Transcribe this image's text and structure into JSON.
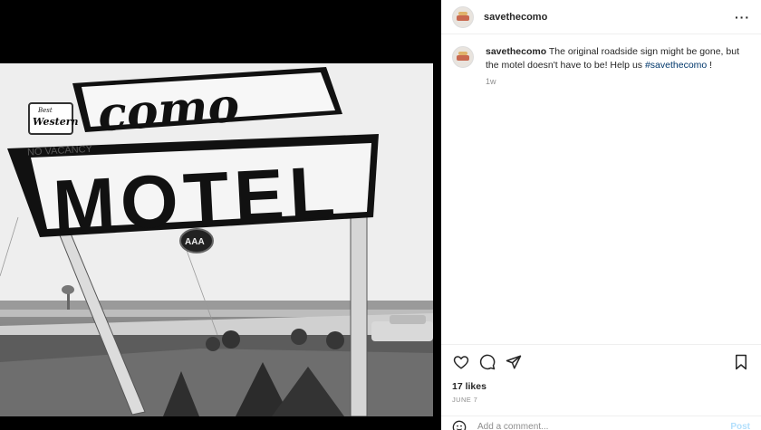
{
  "post": {
    "username": "savethecomo",
    "caption_user": "savethecomo",
    "caption_text": " The original roadside sign might be gone, but the motel doesn't have to be! Help us ",
    "hashtag": "#savethecomo",
    "caption_tail": " !",
    "age": "1w",
    "likes": "17 likes",
    "date": "JUNE 7",
    "comment_placeholder": "Add a comment...",
    "post_label": "Post",
    "more_label": "···"
  },
  "photo": {
    "sign_top": "como",
    "sign_main": "MOTEL",
    "small_sign_line1": "Best",
    "small_sign_line2": "Western",
    "vacancy": "NO VACANCY",
    "aaa": "AAA"
  },
  "icons": [
    "heart-icon",
    "comment-icon",
    "share-icon",
    "bookmark-icon",
    "emoji-icon",
    "more-icon"
  ],
  "colors": {
    "link": "#00376b",
    "muted": "#8e8e8e",
    "post_disabled": "#b2dffc"
  }
}
